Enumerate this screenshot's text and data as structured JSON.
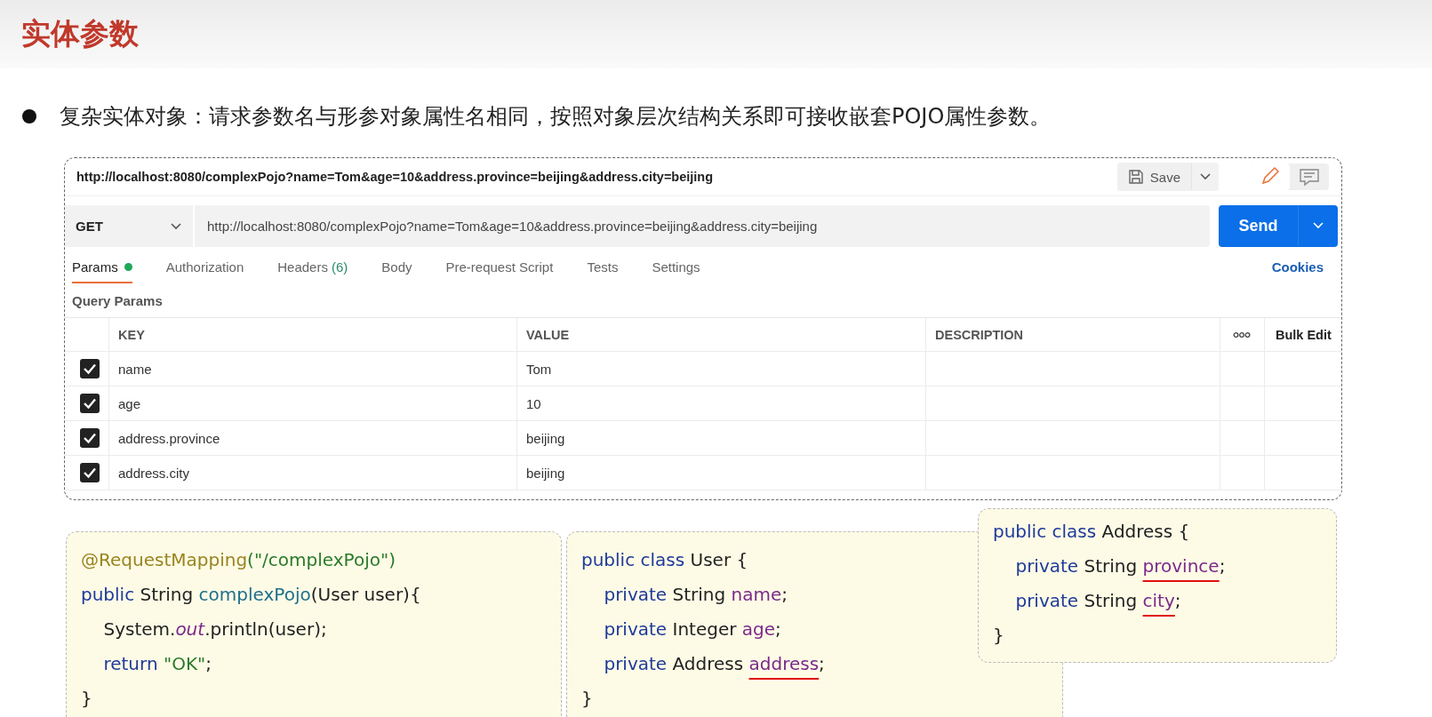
{
  "slide": {
    "title": "实体参数",
    "bullet": "复杂实体对象：请求参数名与形参对象属性名相同，按照对象层次结构关系即可接收嵌套POJO属性参数。"
  },
  "postman": {
    "request_name": "http://localhost:8080/complexPojo?name=Tom&age=10&address.province=beijing&address.city=beijing",
    "save": "Save",
    "method": "GET",
    "url": "http://localhost:8080/complexPojo?name=Tom&age=10&address.province=beijing&address.city=beijing",
    "send": "Send",
    "tabs": [
      {
        "label": "Params",
        "selected": true,
        "dot": true
      },
      {
        "label": "Authorization",
        "selected": false,
        "dot": false
      },
      {
        "label": "Headers",
        "count": "(6)",
        "selected": false,
        "dot": false
      },
      {
        "label": "Body",
        "selected": false,
        "dot": false
      },
      {
        "label": "Pre-request Script",
        "selected": false,
        "dot": false
      },
      {
        "label": "Tests",
        "selected": false,
        "dot": false
      },
      {
        "label": "Settings",
        "selected": false,
        "dot": false
      }
    ],
    "cookies": "Cookies",
    "section": "Query Params",
    "table": {
      "columns": [
        "KEY",
        "VALUE",
        "DESCRIPTION"
      ],
      "bulk_edit": "Bulk Edit",
      "rows": [
        {
          "checked": true,
          "key": "name",
          "value": "Tom"
        },
        {
          "checked": true,
          "key": "age",
          "value": "10"
        },
        {
          "checked": true,
          "key": "address.province",
          "value": "beijing"
        },
        {
          "checked": true,
          "key": "address.city",
          "value": "beijing"
        }
      ]
    }
  },
  "code_boxes": [
    {
      "lines": [
        [
          {
            "text": "@RequestMapping",
            "kind": "annotation"
          },
          {
            "text": "(\"/complexPojo\")",
            "kind": "string"
          }
        ],
        [
          {
            "text": "public",
            "kind": "keyword"
          },
          {
            "text": " String ",
            "kind": "plain"
          },
          {
            "text": "complexPojo",
            "kind": "method"
          },
          {
            "text": "(User user){",
            "kind": "plain"
          }
        ],
        [
          {
            "text": "    System.",
            "kind": "plain"
          },
          {
            "text": "out",
            "kind": "static"
          },
          {
            "text": ".println(user);",
            "kind": "plain"
          }
        ],
        [
          {
            "text": "    return ",
            "kind": "keyword"
          },
          {
            "text": "\"OK\"",
            "kind": "string"
          },
          {
            "text": ";",
            "kind": "plain"
          }
        ],
        [
          {
            "text": "}",
            "kind": "plain"
          }
        ]
      ]
    },
    {
      "lines": [
        [
          {
            "text": "public class",
            "kind": "keyword"
          },
          {
            "text": " User {",
            "kind": "plain"
          }
        ],
        [
          {
            "text": "    private",
            "kind": "keyword"
          },
          {
            "text": " String ",
            "kind": "plain"
          },
          {
            "text": "name",
            "kind": "field"
          },
          {
            "text": ";",
            "kind": "plain"
          }
        ],
        [
          {
            "text": "    private",
            "kind": "keyword"
          },
          {
            "text": " Integer ",
            "kind": "plain"
          },
          {
            "text": "age",
            "kind": "field"
          },
          {
            "text": ";",
            "kind": "plain"
          }
        ],
        [
          {
            "text": "    private",
            "kind": "keyword"
          },
          {
            "text": " Address ",
            "kind": "plain"
          },
          {
            "text": "address",
            "kind": "field",
            "underlined": true
          },
          {
            "text": ";",
            "kind": "plain"
          }
        ],
        [
          {
            "text": "}",
            "kind": "plain"
          }
        ]
      ]
    },
    {
      "lines": [
        [
          {
            "text": "public class",
            "kind": "keyword"
          },
          {
            "text": " Address {",
            "kind": "plain"
          }
        ],
        [
          {
            "text": "    private",
            "kind": "keyword"
          },
          {
            "text": " String ",
            "kind": "plain"
          },
          {
            "text": "province",
            "kind": "field",
            "underlined": true
          },
          {
            "text": ";",
            "kind": "plain"
          }
        ],
        [
          {
            "text": "    private",
            "kind": "keyword"
          },
          {
            "text": " String ",
            "kind": "plain"
          },
          {
            "text": "city",
            "kind": "field",
            "underlined": true
          },
          {
            "text": ";",
            "kind": "plain"
          }
        ],
        [
          {
            "text": "}",
            "kind": "plain"
          }
        ]
      ]
    }
  ]
}
